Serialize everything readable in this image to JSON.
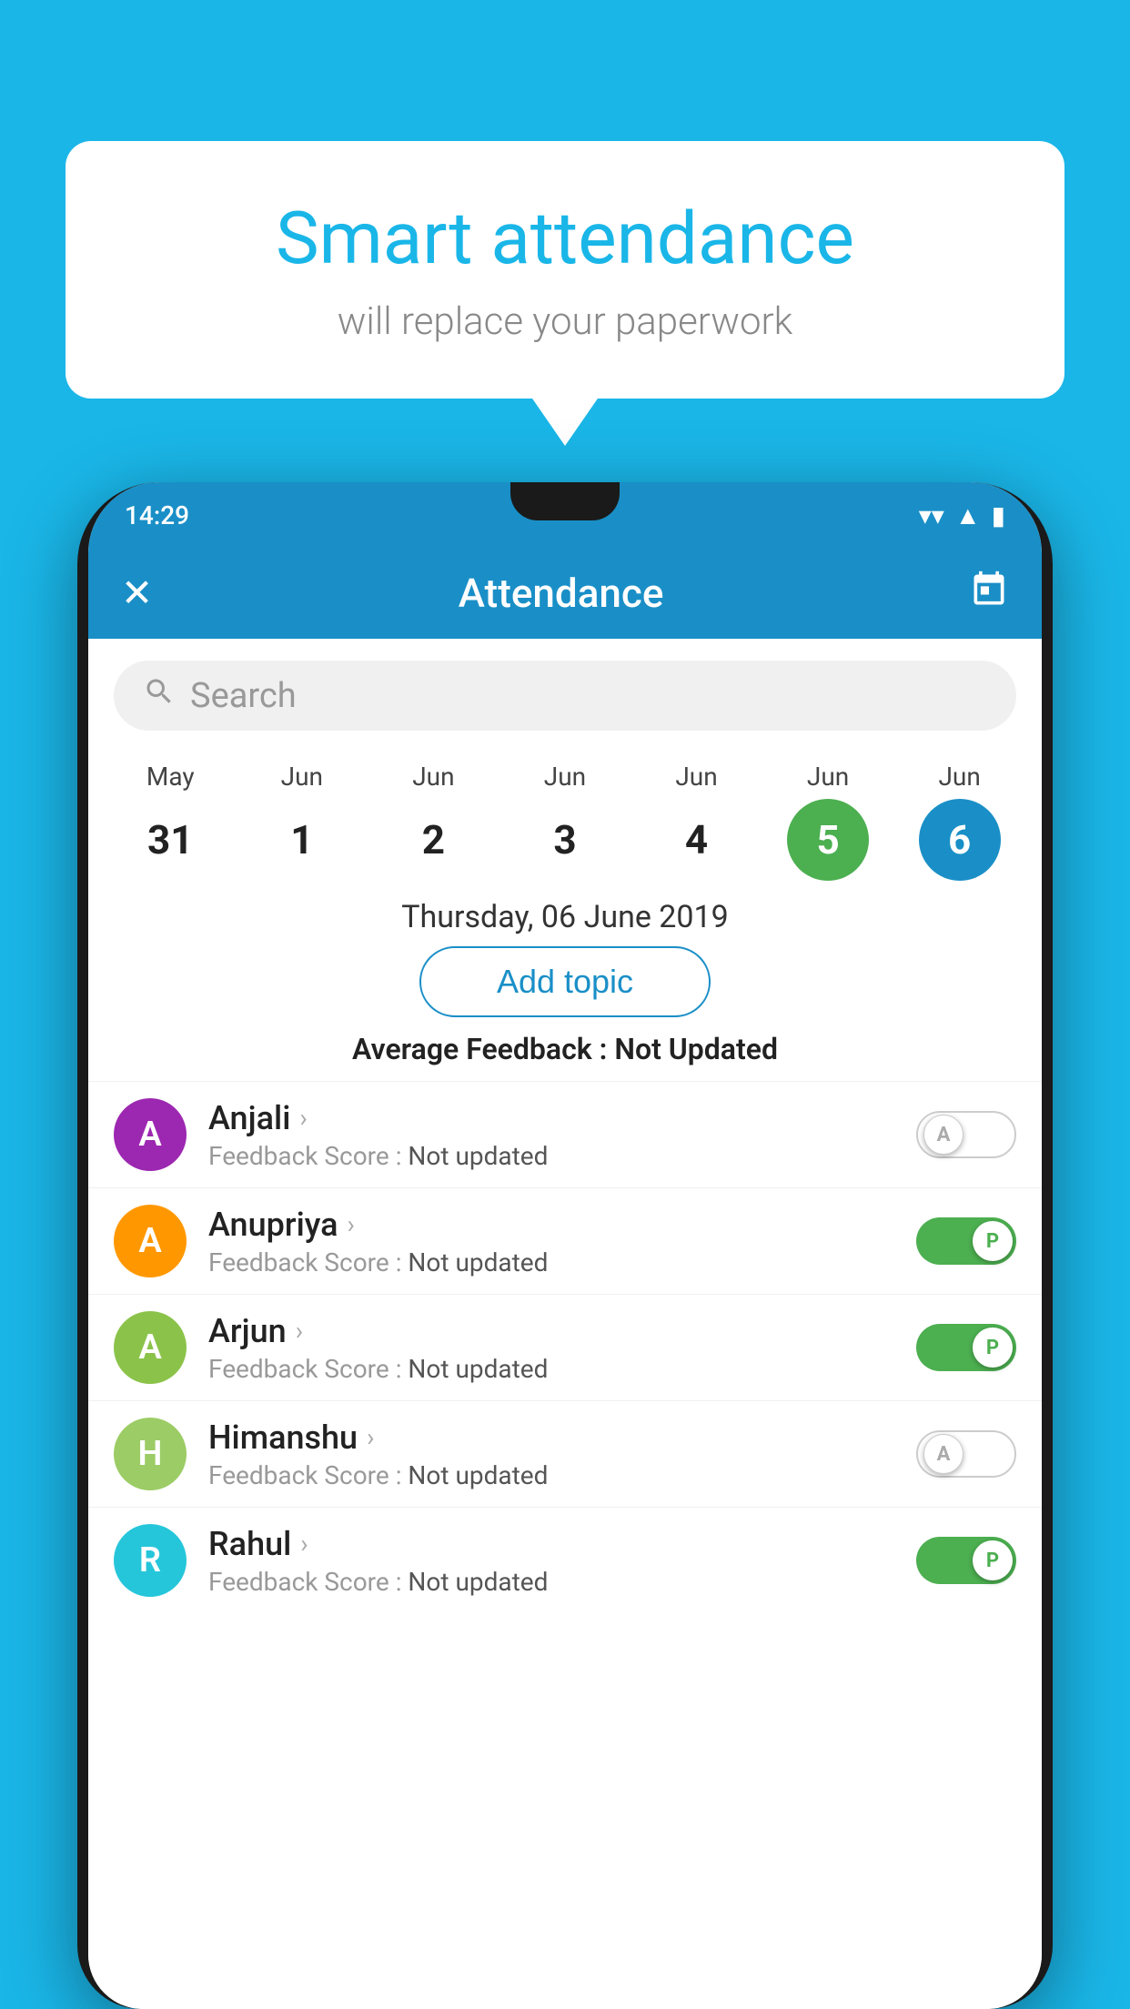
{
  "background_color": "#1ab6e8",
  "speech_bubble": {
    "title": "Smart attendance",
    "subtitle": "will replace your paperwork"
  },
  "status_bar": {
    "time": "14:29",
    "wifi_icon": "▼",
    "signal_icon": "▲",
    "battery_icon": "▮"
  },
  "app_bar": {
    "close_label": "✕",
    "title": "Attendance",
    "calendar_icon": "📅"
  },
  "search": {
    "placeholder": "Search"
  },
  "dates": [
    {
      "month": "May",
      "day": "31",
      "state": "normal"
    },
    {
      "month": "Jun",
      "day": "1",
      "state": "normal"
    },
    {
      "month": "Jun",
      "day": "2",
      "state": "normal"
    },
    {
      "month": "Jun",
      "day": "3",
      "state": "normal"
    },
    {
      "month": "Jun",
      "day": "4",
      "state": "normal"
    },
    {
      "month": "Jun",
      "day": "5",
      "state": "today"
    },
    {
      "month": "Jun",
      "day": "6",
      "state": "selected"
    }
  ],
  "selected_date_label": "Thursday, 06 June 2019",
  "add_topic_button": "Add topic",
  "average_feedback": {
    "label": "Average Feedback : ",
    "value": "Not Updated"
  },
  "students": [
    {
      "name": "Anjali",
      "avatar_letter": "A",
      "avatar_color": "#9c27b0",
      "feedback_label": "Feedback Score : ",
      "feedback_value": "Not updated",
      "toggle_state": "off",
      "toggle_label": "A"
    },
    {
      "name": "Anupriya",
      "avatar_letter": "A",
      "avatar_color": "#ff9800",
      "feedback_label": "Feedback Score : ",
      "feedback_value": "Not updated",
      "toggle_state": "on",
      "toggle_label": "P"
    },
    {
      "name": "Arjun",
      "avatar_letter": "A",
      "avatar_color": "#8bc34a",
      "feedback_label": "Feedback Score : ",
      "feedback_value": "Not updated",
      "toggle_state": "on",
      "toggle_label": "P"
    },
    {
      "name": "Himanshu",
      "avatar_letter": "H",
      "avatar_color": "#9ccc65",
      "feedback_label": "Feedback Score : ",
      "feedback_value": "Not updated",
      "toggle_state": "off",
      "toggle_label": "A"
    },
    {
      "name": "Rahul",
      "avatar_letter": "R",
      "avatar_color": "#26c6da",
      "feedback_label": "Feedback Score : ",
      "feedback_value": "Not updated",
      "toggle_state": "on",
      "toggle_label": "P"
    }
  ]
}
